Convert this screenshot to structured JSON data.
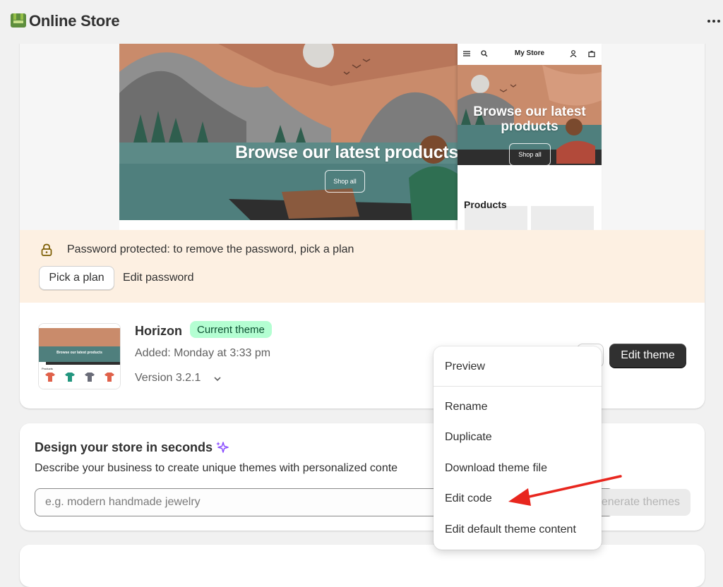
{
  "app": {
    "title": "Online Store",
    "logo_icon": "shopify-bag-icon",
    "more_icon": "more-horizontal-icon"
  },
  "preview": {
    "desktop_heading": "Browse our latest products",
    "desktop_button": "Shop all",
    "mobile_store_name": "My Store",
    "mobile_heading": "Browse our latest products",
    "mobile_button": "Shop all",
    "mobile_section": "Products"
  },
  "password_banner": {
    "message": "Password protected: to remove the password, pick a plan",
    "primary_action": "Pick a plan",
    "secondary_action": "Edit password",
    "background": "#fdf0e2"
  },
  "theme": {
    "name": "Horizon",
    "badge": "Current theme",
    "added": "Added: Monday at 3:33 pm",
    "version": "Version 3.2.1",
    "edit_button": "Edit theme",
    "thumb_heading": "Browse our latest products",
    "thumb_section": "Products"
  },
  "actions_menu": {
    "items": [
      "Preview",
      "Rename",
      "Duplicate",
      "Download theme file",
      "Edit code",
      "Edit default theme content"
    ]
  },
  "design": {
    "title": "Design your store in seconds",
    "description": "Describe your business to create unique themes with personalized conte",
    "placeholder": "e.g. modern handmade jewelry",
    "button": "enerate themes",
    "sparkle_color": "#8a4dff"
  },
  "annotation": {
    "arrow_color": "#e8261e"
  }
}
